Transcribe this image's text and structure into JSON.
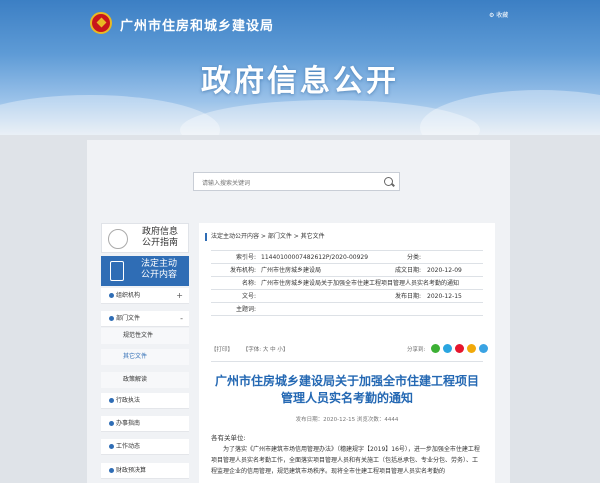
{
  "header": {
    "site_title": "广州市住房和城乡建设局",
    "favorite_label": "收藏",
    "big_title": "政府信息公开"
  },
  "search": {
    "placeholder": "请输入搜索关键词"
  },
  "sidebar": {
    "guide_label_1": "政府信息",
    "guide_label_2": "公开指南",
    "legal_label_1": "法定主动",
    "legal_label_2": "公开内容",
    "items": [
      {
        "label": "组织机构",
        "toggle": "+"
      },
      {
        "label": "部门文件",
        "toggle": "-"
      },
      {
        "label": "行政执法",
        "toggle": ""
      },
      {
        "label": "办事指南",
        "toggle": ""
      },
      {
        "label": "工作动态",
        "toggle": ""
      },
      {
        "label": "财政预决算",
        "toggle": ""
      }
    ],
    "subitems": [
      "规范性文件",
      "其它文件",
      "政策解读"
    ]
  },
  "breadcrumb": "法定主动公开内容 > 部门文件 > 其它文件",
  "meta": {
    "index_label": "索引号:",
    "index_value": "11440100007482612P/2020-00929",
    "category_label": "分类:",
    "category_value": "",
    "issuer_label": "发布机构:",
    "issuer_value": "广州市住房城乡建设局",
    "date_label": "成文日期:",
    "date_value": "2020-12-09",
    "name_label": "名称:",
    "name_value": "广州市住房城乡建设局关于加强全市住建工程项目管理人员实名考勤的通知",
    "docno_label": "文号:",
    "docno_value": "",
    "pubdate_label": "发布日期:",
    "pubdate_value": "2020-12-15",
    "subject_label": "主题词:",
    "subject_value": ""
  },
  "tools": {
    "print": "【打印】",
    "font": "【字体:  大  中  小】",
    "share": "分享到:"
  },
  "share_colors": [
    "#3cb034",
    "#2aa5e0",
    "#e6162d",
    "#f1a90a",
    "#3aa3e3"
  ],
  "article": {
    "title": "广州市住房城乡建设局关于加强全市住建工程项目管理人员实名考勤的通知",
    "info": "发布日期：2020-12-15  浏览次数：4444",
    "salutation": "各有关单位:",
    "body": "为了落实《广州市建筑市场信用管理办法》（穗建规字【2019】16号），进一步加强全市住建工程项目管理人员实名考勤工作，全面落实项目管理人员和有关施工（包括总承包、专业分包、劳务）、工程监理企业的信用管理，规范建筑市场秩序。现将全市住建工程项目管理人员实名考勤的"
  }
}
